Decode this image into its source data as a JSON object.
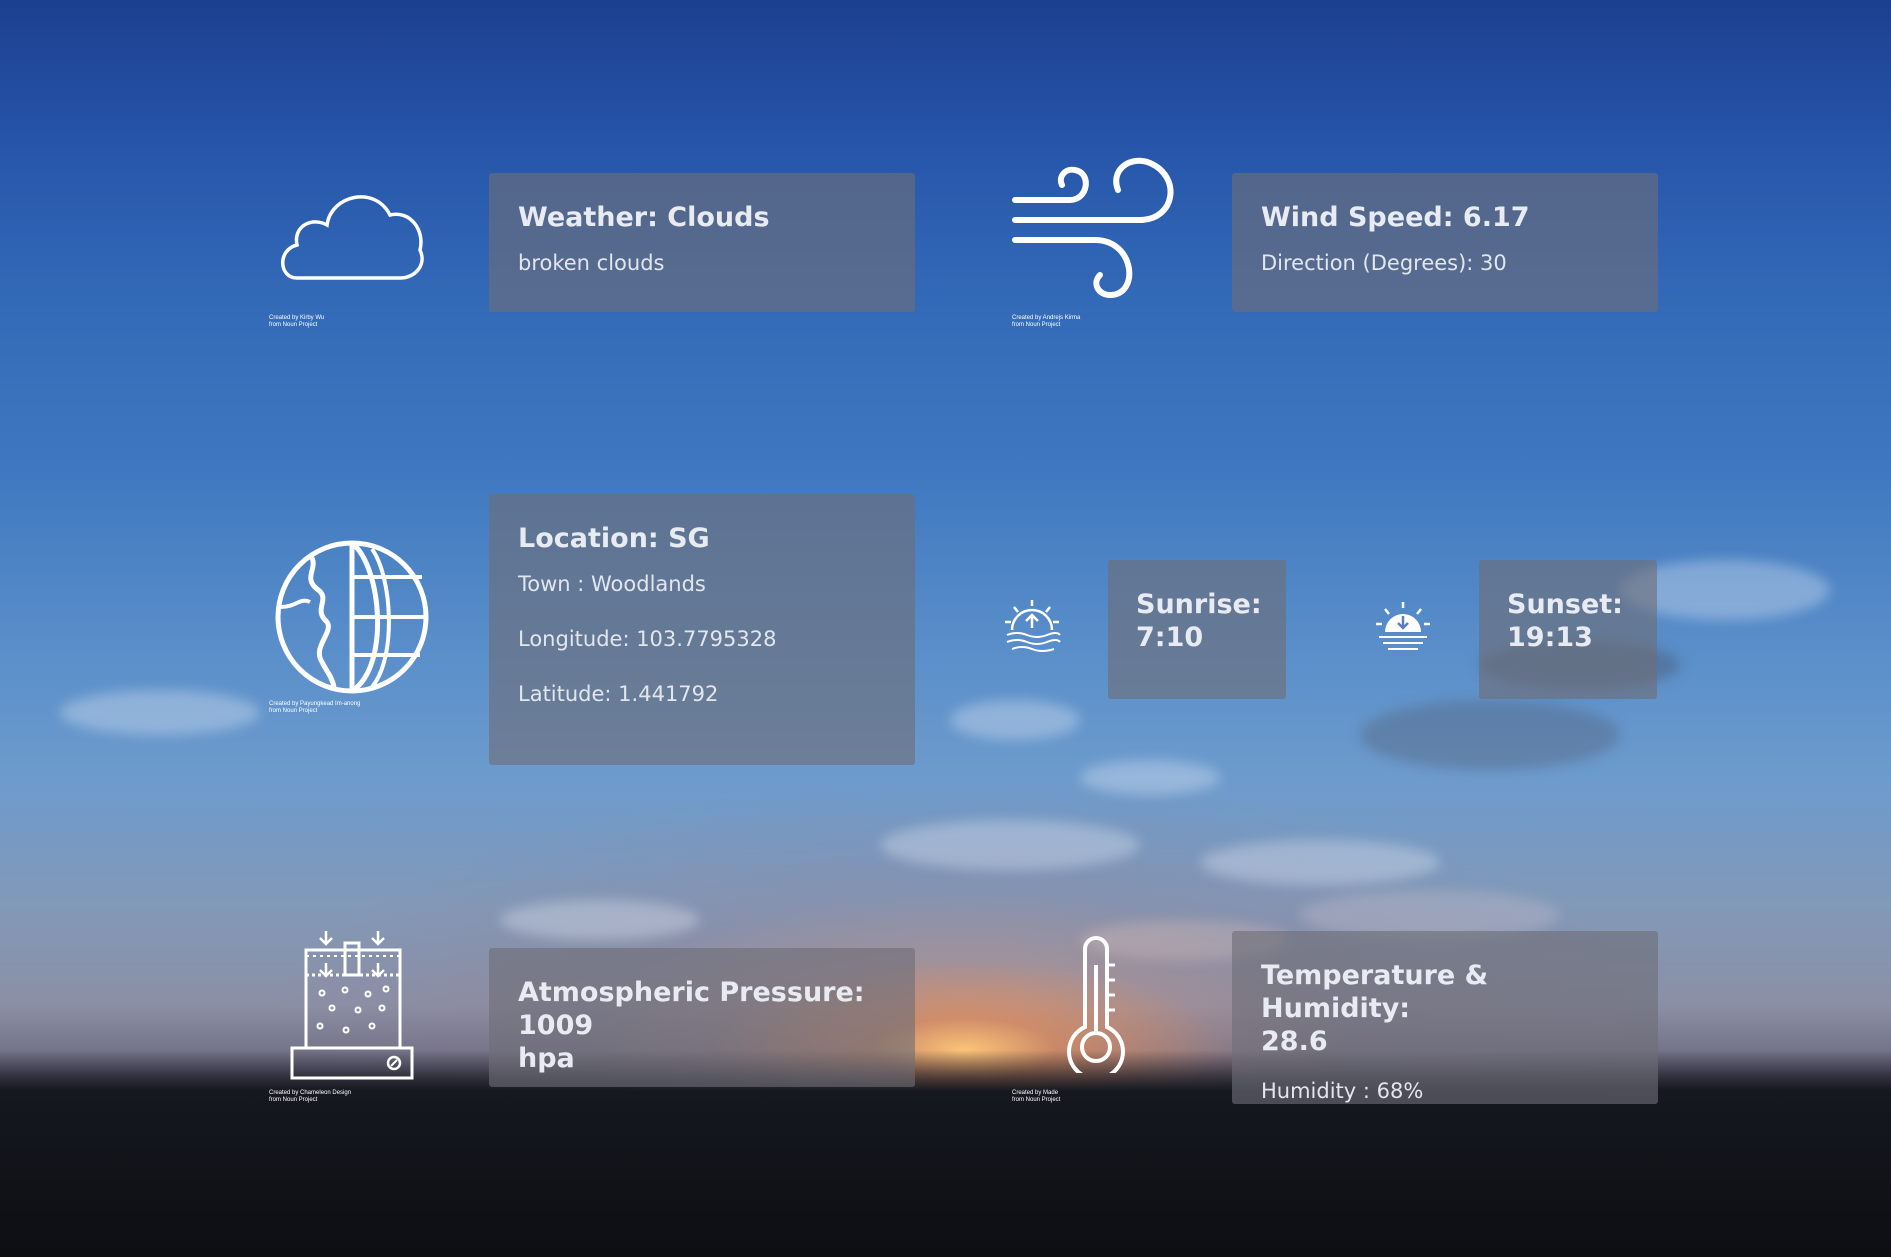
{
  "weather": {
    "title": "Weather: Clouds",
    "desc": "broken clouds",
    "credit_1": "Created by Kirby Wu",
    "credit_2": "from Noun Project"
  },
  "wind": {
    "title": "Wind Speed: 6.17",
    "direction": "Direction (Degrees): 30",
    "credit_1": "Created by Andrejs Kirma",
    "credit_2": "from Noun Project"
  },
  "location": {
    "title": "Location: SG",
    "town": "Town : Woodlands",
    "longitude": "Longitude: 103.7795328",
    "latitude": "Latitude: 1.441792",
    "credit_1": "Created by Payungkead Im-anong",
    "credit_2": "from Noun Project"
  },
  "sunrise": {
    "label": "Sunrise:",
    "time": "7:10"
  },
  "sunset": {
    "label": "Sunset:",
    "time": "19:13"
  },
  "pressure": {
    "title_1": "Atmospheric Pressure: 1009",
    "title_2": "hpa",
    "credit_1": "Created by Chameleon Design",
    "credit_2": "from Noun Project"
  },
  "temperature": {
    "title_1": "Temperature & Humidity:",
    "title_2": "28.6",
    "humidity": "Humidity : 68%",
    "credit_1": "Created by Made",
    "credit_2": "from Noun Project"
  },
  "icons": [
    "cloud-icon",
    "wind-icon",
    "globe-icon",
    "sunrise-icon",
    "sunset-icon",
    "pressure-icon",
    "thermometer-icon"
  ]
}
